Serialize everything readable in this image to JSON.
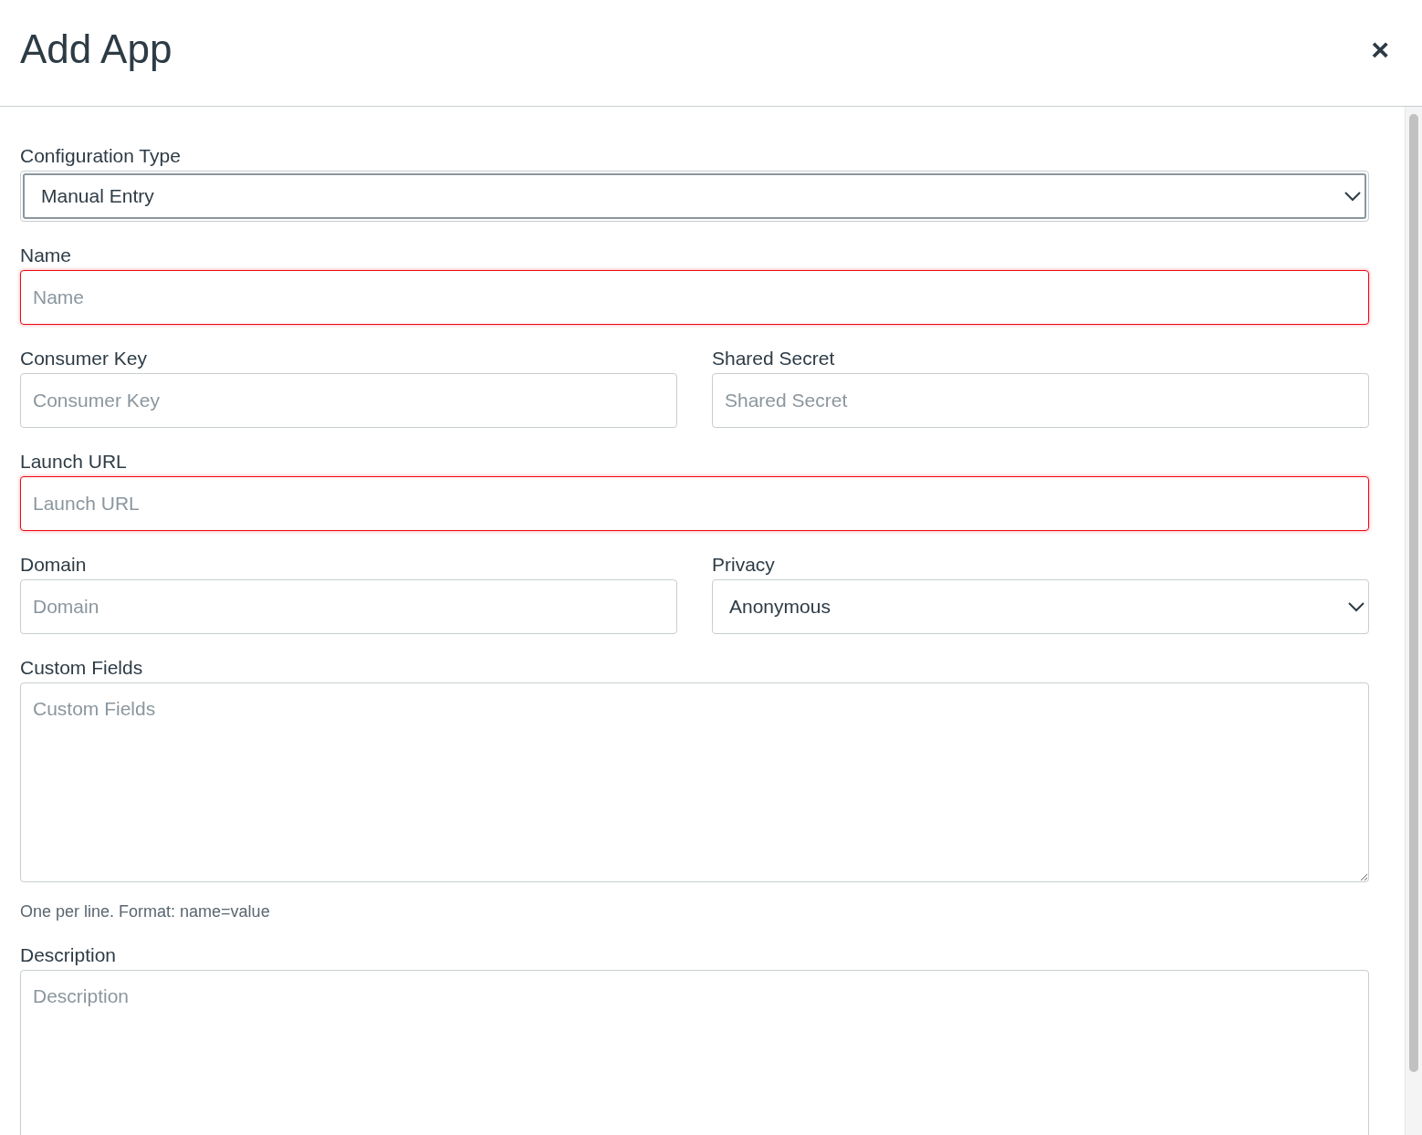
{
  "dialog": {
    "title": "Add App",
    "close": "×"
  },
  "rows": [
    {
      "fields": [
        {
          "kind": "select",
          "label": "Configuration Type",
          "value": "Manual Entry",
          "focused": true
        }
      ]
    },
    {
      "fields": [
        {
          "kind": "text",
          "label": "Name",
          "placeholder": "Name",
          "invalid": true,
          "focused": false
        }
      ]
    },
    {
      "fields": [
        {
          "kind": "text",
          "label": "Consumer Key",
          "placeholder": "Consumer Key",
          "invalid": false,
          "focused": false
        },
        {
          "kind": "text",
          "label": "Shared Secret",
          "placeholder": "Shared Secret",
          "invalid": false,
          "focused": false
        }
      ]
    },
    {
      "fields": [
        {
          "kind": "text",
          "label": "Launch URL",
          "placeholder": "Launch URL",
          "invalid": true,
          "focused": false
        }
      ]
    },
    {
      "fields": [
        {
          "kind": "text",
          "label": "Domain",
          "placeholder": "Domain",
          "invalid": false,
          "focused": false
        },
        {
          "kind": "select",
          "label": "Privacy",
          "value": "Anonymous",
          "focused": false
        }
      ]
    },
    {
      "fields": [
        {
          "kind": "textarea",
          "label": "Custom Fields",
          "placeholder": "Custom Fields",
          "invalid": false,
          "focused": false,
          "hint": "One per line. Format: name=value"
        }
      ]
    },
    {
      "fields": [
        {
          "kind": "textarea",
          "label": "Description",
          "placeholder": "Description",
          "invalid": false,
          "focused": false
        }
      ]
    }
  ]
}
